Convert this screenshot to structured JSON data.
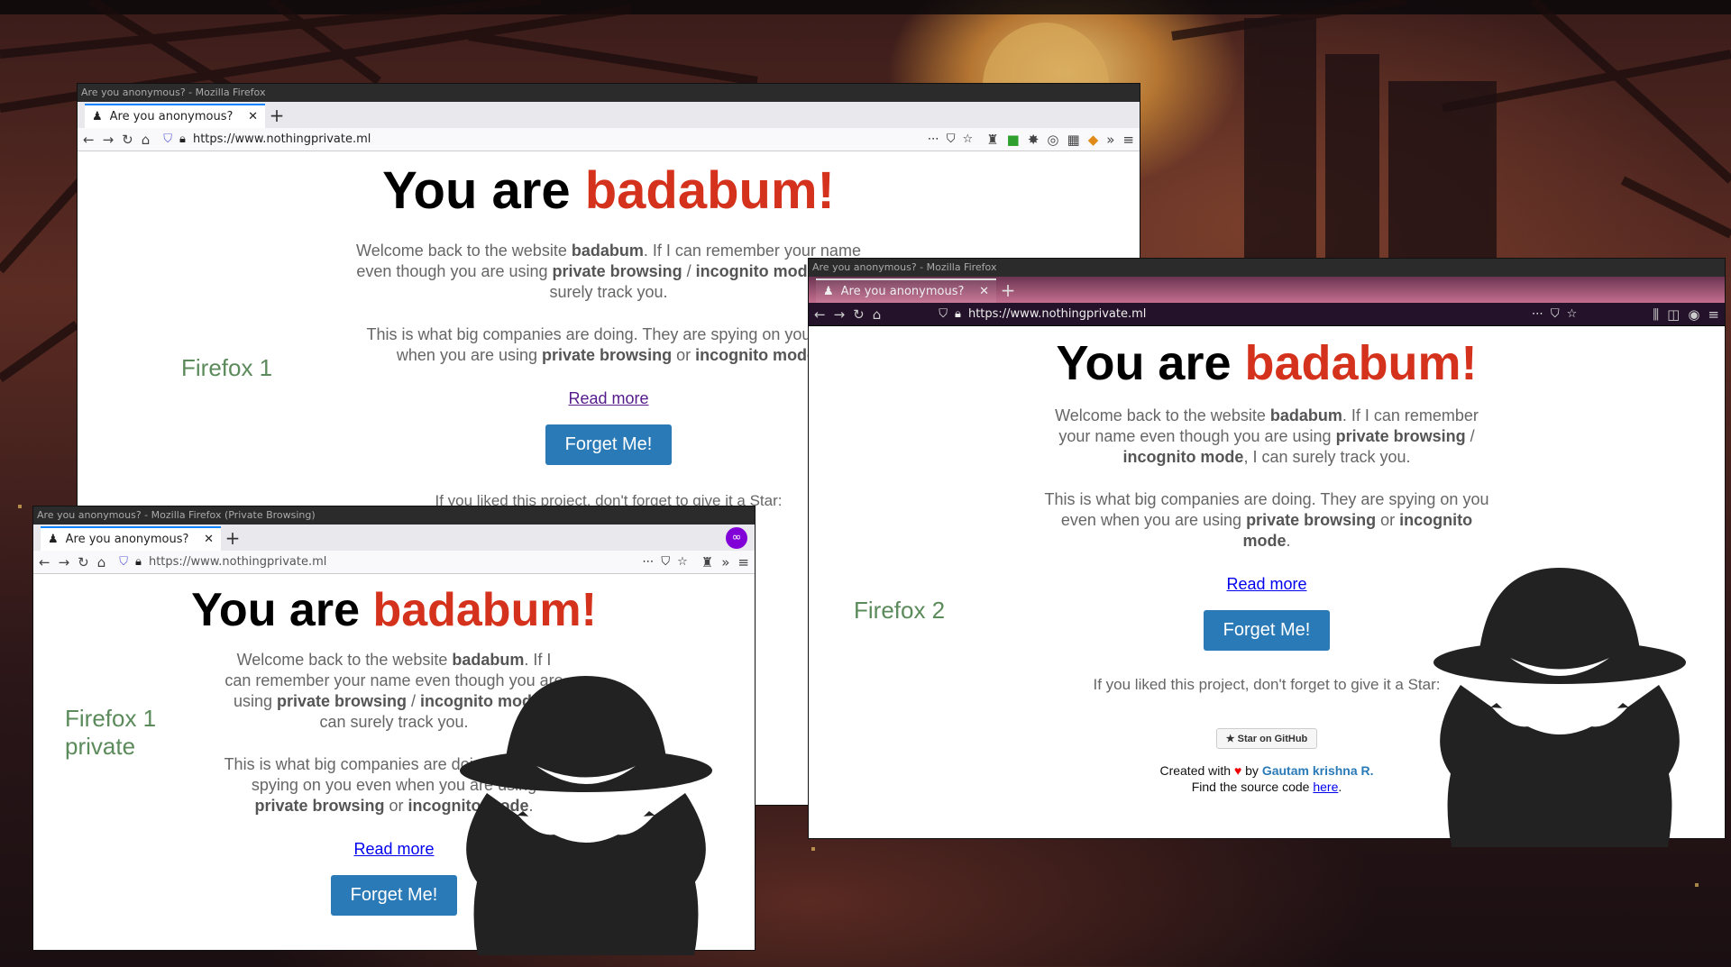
{
  "windows": {
    "firefox1": {
      "title": "Are you anonymous? - Mozilla Firefox",
      "tab_title": "Are you anonymous?",
      "url": "https://www.nothingprivate.ml",
      "label": "Firefox 1"
    },
    "firefox1_private": {
      "title": "Are you anonymous? - Mozilla Firefox (Private Browsing)",
      "tab_title": "Are you anonymous?",
      "url": "https://www.nothingprivate.ml",
      "label": "Firefox 1\nprivate"
    },
    "firefox2": {
      "title": "Are you anonymous? - Mozilla Firefox",
      "tab_title": "Are you anonymous?",
      "url": "https://www.nothingprivate.ml",
      "label": "Firefox 2"
    }
  },
  "site": {
    "heading_prefix": "You are",
    "name": "badabum!",
    "welcome_1": "Welcome back to the website",
    "welcome_name": "badabum",
    "welcome_2": ". If I can remember your name even though you are using",
    "pb": "private browsing",
    "slash": " / ",
    "incognito": "incognito mode",
    "welcome_3": ", I can surely track you.",
    "spying_1": "This is what big companies are doing. They are spying on you even when you are using",
    "or": " or ",
    "period": ".",
    "read_more": "Read more",
    "forget": "Forget Me!",
    "star_text": "If you liked this project, don't forget to give it a Star:",
    "star_button": "Star on GitHub",
    "created_1": "Created with",
    "created_by": "by",
    "author": "Gautam krishna R.",
    "source_1": "Find the source code",
    "source_link": "here",
    "source_end": "."
  },
  "colors": {
    "accent_red": "#d4321c",
    "button_blue": "#2a7ab7",
    "label_green": "#5b8a5b"
  }
}
